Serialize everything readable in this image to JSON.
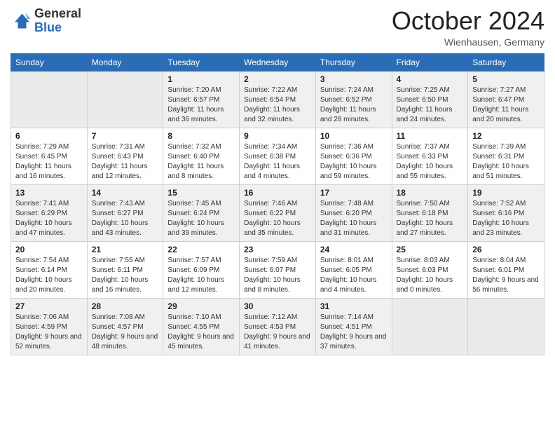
{
  "logo": {
    "general": "General",
    "blue": "Blue"
  },
  "title": "October 2024",
  "location": "Wienhausen, Germany",
  "weekdays": [
    "Sunday",
    "Monday",
    "Tuesday",
    "Wednesday",
    "Thursday",
    "Friday",
    "Saturday"
  ],
  "weeks": [
    [
      {
        "day": "",
        "info": ""
      },
      {
        "day": "",
        "info": ""
      },
      {
        "day": "1",
        "info": "Sunrise: 7:20 AM\nSunset: 6:57 PM\nDaylight: 11 hours and 36 minutes."
      },
      {
        "day": "2",
        "info": "Sunrise: 7:22 AM\nSunset: 6:54 PM\nDaylight: 11 hours and 32 minutes."
      },
      {
        "day": "3",
        "info": "Sunrise: 7:24 AM\nSunset: 6:52 PM\nDaylight: 11 hours and 28 minutes."
      },
      {
        "day": "4",
        "info": "Sunrise: 7:25 AM\nSunset: 6:50 PM\nDaylight: 11 hours and 24 minutes."
      },
      {
        "day": "5",
        "info": "Sunrise: 7:27 AM\nSunset: 6:47 PM\nDaylight: 11 hours and 20 minutes."
      }
    ],
    [
      {
        "day": "6",
        "info": "Sunrise: 7:29 AM\nSunset: 6:45 PM\nDaylight: 11 hours and 16 minutes."
      },
      {
        "day": "7",
        "info": "Sunrise: 7:31 AM\nSunset: 6:43 PM\nDaylight: 11 hours and 12 minutes."
      },
      {
        "day": "8",
        "info": "Sunrise: 7:32 AM\nSunset: 6:40 PM\nDaylight: 11 hours and 8 minutes."
      },
      {
        "day": "9",
        "info": "Sunrise: 7:34 AM\nSunset: 6:38 PM\nDaylight: 11 hours and 4 minutes."
      },
      {
        "day": "10",
        "info": "Sunrise: 7:36 AM\nSunset: 6:36 PM\nDaylight: 10 hours and 59 minutes."
      },
      {
        "day": "11",
        "info": "Sunrise: 7:37 AM\nSunset: 6:33 PM\nDaylight: 10 hours and 55 minutes."
      },
      {
        "day": "12",
        "info": "Sunrise: 7:39 AM\nSunset: 6:31 PM\nDaylight: 10 hours and 51 minutes."
      }
    ],
    [
      {
        "day": "13",
        "info": "Sunrise: 7:41 AM\nSunset: 6:29 PM\nDaylight: 10 hours and 47 minutes."
      },
      {
        "day": "14",
        "info": "Sunrise: 7:43 AM\nSunset: 6:27 PM\nDaylight: 10 hours and 43 minutes."
      },
      {
        "day": "15",
        "info": "Sunrise: 7:45 AM\nSunset: 6:24 PM\nDaylight: 10 hours and 39 minutes."
      },
      {
        "day": "16",
        "info": "Sunrise: 7:46 AM\nSunset: 6:22 PM\nDaylight: 10 hours and 35 minutes."
      },
      {
        "day": "17",
        "info": "Sunrise: 7:48 AM\nSunset: 6:20 PM\nDaylight: 10 hours and 31 minutes."
      },
      {
        "day": "18",
        "info": "Sunrise: 7:50 AM\nSunset: 6:18 PM\nDaylight: 10 hours and 27 minutes."
      },
      {
        "day": "19",
        "info": "Sunrise: 7:52 AM\nSunset: 6:16 PM\nDaylight: 10 hours and 23 minutes."
      }
    ],
    [
      {
        "day": "20",
        "info": "Sunrise: 7:54 AM\nSunset: 6:14 PM\nDaylight: 10 hours and 20 minutes."
      },
      {
        "day": "21",
        "info": "Sunrise: 7:55 AM\nSunset: 6:11 PM\nDaylight: 10 hours and 16 minutes."
      },
      {
        "day": "22",
        "info": "Sunrise: 7:57 AM\nSunset: 6:09 PM\nDaylight: 10 hours and 12 minutes."
      },
      {
        "day": "23",
        "info": "Sunrise: 7:59 AM\nSunset: 6:07 PM\nDaylight: 10 hours and 8 minutes."
      },
      {
        "day": "24",
        "info": "Sunrise: 8:01 AM\nSunset: 6:05 PM\nDaylight: 10 hours and 4 minutes."
      },
      {
        "day": "25",
        "info": "Sunrise: 8:03 AM\nSunset: 6:03 PM\nDaylight: 10 hours and 0 minutes."
      },
      {
        "day": "26",
        "info": "Sunrise: 8:04 AM\nSunset: 6:01 PM\nDaylight: 9 hours and 56 minutes."
      }
    ],
    [
      {
        "day": "27",
        "info": "Sunrise: 7:06 AM\nSunset: 4:59 PM\nDaylight: 9 hours and 52 minutes."
      },
      {
        "day": "28",
        "info": "Sunrise: 7:08 AM\nSunset: 4:57 PM\nDaylight: 9 hours and 48 minutes."
      },
      {
        "day": "29",
        "info": "Sunrise: 7:10 AM\nSunset: 4:55 PM\nDaylight: 9 hours and 45 minutes."
      },
      {
        "day": "30",
        "info": "Sunrise: 7:12 AM\nSunset: 4:53 PM\nDaylight: 9 hours and 41 minutes."
      },
      {
        "day": "31",
        "info": "Sunrise: 7:14 AM\nSunset: 4:51 PM\nDaylight: 9 hours and 37 minutes."
      },
      {
        "day": "",
        "info": ""
      },
      {
        "day": "",
        "info": ""
      }
    ]
  ]
}
